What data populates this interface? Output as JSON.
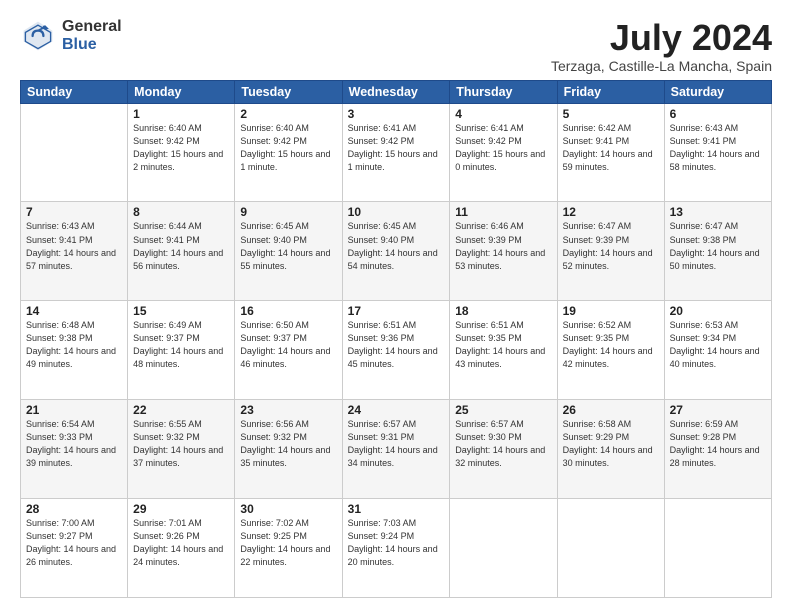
{
  "header": {
    "logo_general": "General",
    "logo_blue": "Blue",
    "month_title": "July 2024",
    "location": "Terzaga, Castille-La Mancha, Spain"
  },
  "weekdays": [
    "Sunday",
    "Monday",
    "Tuesday",
    "Wednesday",
    "Thursday",
    "Friday",
    "Saturday"
  ],
  "weeks": [
    [
      {
        "day": "",
        "sunrise": "",
        "sunset": "",
        "daylight": ""
      },
      {
        "day": "1",
        "sunrise": "Sunrise: 6:40 AM",
        "sunset": "Sunset: 9:42 PM",
        "daylight": "Daylight: 15 hours and 2 minutes."
      },
      {
        "day": "2",
        "sunrise": "Sunrise: 6:40 AM",
        "sunset": "Sunset: 9:42 PM",
        "daylight": "Daylight: 15 hours and 1 minute."
      },
      {
        "day": "3",
        "sunrise": "Sunrise: 6:41 AM",
        "sunset": "Sunset: 9:42 PM",
        "daylight": "Daylight: 15 hours and 1 minute."
      },
      {
        "day": "4",
        "sunrise": "Sunrise: 6:41 AM",
        "sunset": "Sunset: 9:42 PM",
        "daylight": "Daylight: 15 hours and 0 minutes."
      },
      {
        "day": "5",
        "sunrise": "Sunrise: 6:42 AM",
        "sunset": "Sunset: 9:41 PM",
        "daylight": "Daylight: 14 hours and 59 minutes."
      },
      {
        "day": "6",
        "sunrise": "Sunrise: 6:43 AM",
        "sunset": "Sunset: 9:41 PM",
        "daylight": "Daylight: 14 hours and 58 minutes."
      }
    ],
    [
      {
        "day": "7",
        "sunrise": "Sunrise: 6:43 AM",
        "sunset": "Sunset: 9:41 PM",
        "daylight": "Daylight: 14 hours and 57 minutes."
      },
      {
        "day": "8",
        "sunrise": "Sunrise: 6:44 AM",
        "sunset": "Sunset: 9:41 PM",
        "daylight": "Daylight: 14 hours and 56 minutes."
      },
      {
        "day": "9",
        "sunrise": "Sunrise: 6:45 AM",
        "sunset": "Sunset: 9:40 PM",
        "daylight": "Daylight: 14 hours and 55 minutes."
      },
      {
        "day": "10",
        "sunrise": "Sunrise: 6:45 AM",
        "sunset": "Sunset: 9:40 PM",
        "daylight": "Daylight: 14 hours and 54 minutes."
      },
      {
        "day": "11",
        "sunrise": "Sunrise: 6:46 AM",
        "sunset": "Sunset: 9:39 PM",
        "daylight": "Daylight: 14 hours and 53 minutes."
      },
      {
        "day": "12",
        "sunrise": "Sunrise: 6:47 AM",
        "sunset": "Sunset: 9:39 PM",
        "daylight": "Daylight: 14 hours and 52 minutes."
      },
      {
        "day": "13",
        "sunrise": "Sunrise: 6:47 AM",
        "sunset": "Sunset: 9:38 PM",
        "daylight": "Daylight: 14 hours and 50 minutes."
      }
    ],
    [
      {
        "day": "14",
        "sunrise": "Sunrise: 6:48 AM",
        "sunset": "Sunset: 9:38 PM",
        "daylight": "Daylight: 14 hours and 49 minutes."
      },
      {
        "day": "15",
        "sunrise": "Sunrise: 6:49 AM",
        "sunset": "Sunset: 9:37 PM",
        "daylight": "Daylight: 14 hours and 48 minutes."
      },
      {
        "day": "16",
        "sunrise": "Sunrise: 6:50 AM",
        "sunset": "Sunset: 9:37 PM",
        "daylight": "Daylight: 14 hours and 46 minutes."
      },
      {
        "day": "17",
        "sunrise": "Sunrise: 6:51 AM",
        "sunset": "Sunset: 9:36 PM",
        "daylight": "Daylight: 14 hours and 45 minutes."
      },
      {
        "day": "18",
        "sunrise": "Sunrise: 6:51 AM",
        "sunset": "Sunset: 9:35 PM",
        "daylight": "Daylight: 14 hours and 43 minutes."
      },
      {
        "day": "19",
        "sunrise": "Sunrise: 6:52 AM",
        "sunset": "Sunset: 9:35 PM",
        "daylight": "Daylight: 14 hours and 42 minutes."
      },
      {
        "day": "20",
        "sunrise": "Sunrise: 6:53 AM",
        "sunset": "Sunset: 9:34 PM",
        "daylight": "Daylight: 14 hours and 40 minutes."
      }
    ],
    [
      {
        "day": "21",
        "sunrise": "Sunrise: 6:54 AM",
        "sunset": "Sunset: 9:33 PM",
        "daylight": "Daylight: 14 hours and 39 minutes."
      },
      {
        "day": "22",
        "sunrise": "Sunrise: 6:55 AM",
        "sunset": "Sunset: 9:32 PM",
        "daylight": "Daylight: 14 hours and 37 minutes."
      },
      {
        "day": "23",
        "sunrise": "Sunrise: 6:56 AM",
        "sunset": "Sunset: 9:32 PM",
        "daylight": "Daylight: 14 hours and 35 minutes."
      },
      {
        "day": "24",
        "sunrise": "Sunrise: 6:57 AM",
        "sunset": "Sunset: 9:31 PM",
        "daylight": "Daylight: 14 hours and 34 minutes."
      },
      {
        "day": "25",
        "sunrise": "Sunrise: 6:57 AM",
        "sunset": "Sunset: 9:30 PM",
        "daylight": "Daylight: 14 hours and 32 minutes."
      },
      {
        "day": "26",
        "sunrise": "Sunrise: 6:58 AM",
        "sunset": "Sunset: 9:29 PM",
        "daylight": "Daylight: 14 hours and 30 minutes."
      },
      {
        "day": "27",
        "sunrise": "Sunrise: 6:59 AM",
        "sunset": "Sunset: 9:28 PM",
        "daylight": "Daylight: 14 hours and 28 minutes."
      }
    ],
    [
      {
        "day": "28",
        "sunrise": "Sunrise: 7:00 AM",
        "sunset": "Sunset: 9:27 PM",
        "daylight": "Daylight: 14 hours and 26 minutes."
      },
      {
        "day": "29",
        "sunrise": "Sunrise: 7:01 AM",
        "sunset": "Sunset: 9:26 PM",
        "daylight": "Daylight: 14 hours and 24 minutes."
      },
      {
        "day": "30",
        "sunrise": "Sunrise: 7:02 AM",
        "sunset": "Sunset: 9:25 PM",
        "daylight": "Daylight: 14 hours and 22 minutes."
      },
      {
        "day": "31",
        "sunrise": "Sunrise: 7:03 AM",
        "sunset": "Sunset: 9:24 PM",
        "daylight": "Daylight: 14 hours and 20 minutes."
      },
      {
        "day": "",
        "sunrise": "",
        "sunset": "",
        "daylight": ""
      },
      {
        "day": "",
        "sunrise": "",
        "sunset": "",
        "daylight": ""
      },
      {
        "day": "",
        "sunrise": "",
        "sunset": "",
        "daylight": ""
      }
    ]
  ]
}
